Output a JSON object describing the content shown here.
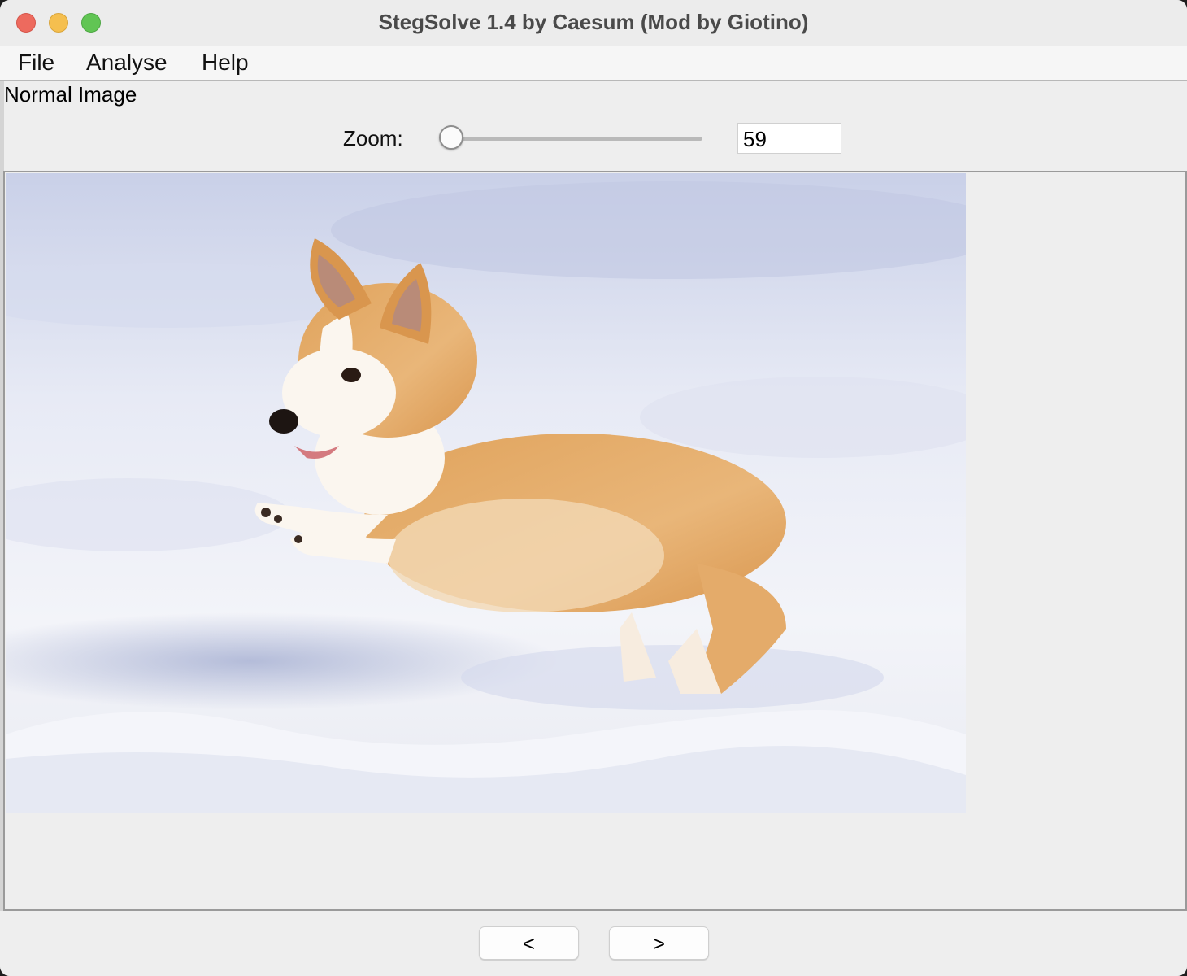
{
  "window": {
    "title": "StegSolve 1.4 by Caesum (Mod by Giotino)"
  },
  "menu": {
    "file": "File",
    "analyse": "Analyse",
    "help": "Help"
  },
  "view": {
    "mode_label": "Normal Image"
  },
  "zoom": {
    "label": "Zoom:",
    "value": "59"
  },
  "nav": {
    "prev": "<",
    "next": ">"
  },
  "image": {
    "subject": "corgi jumping in snow"
  },
  "colors": {
    "window_bg": "#eeeeee",
    "close": "#ed6a5e",
    "minimize": "#f5bf4f",
    "maximize": "#61c554"
  }
}
